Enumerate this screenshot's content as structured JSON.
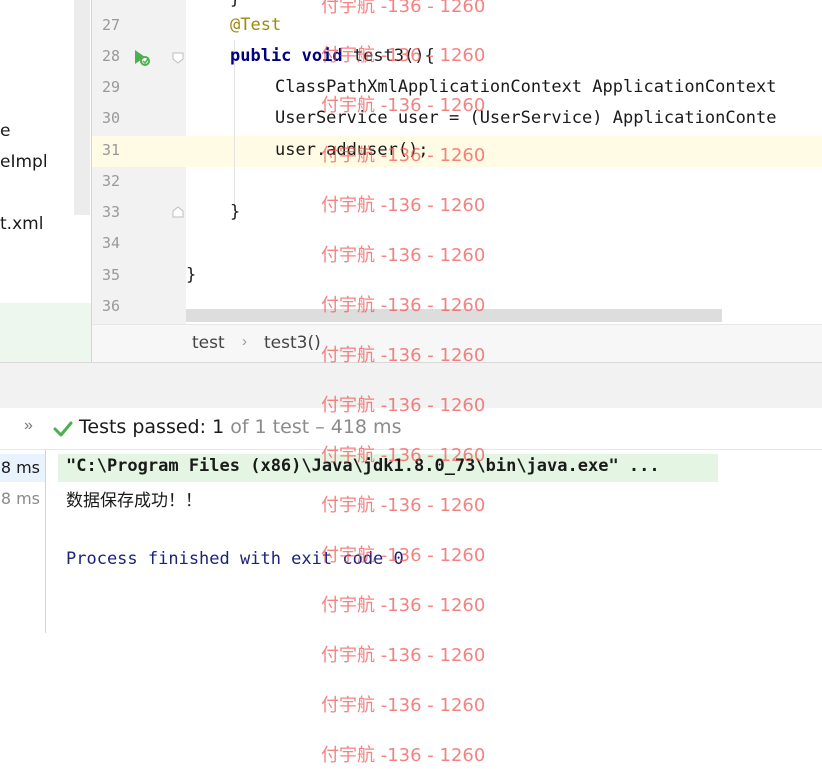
{
  "project_tree": {
    "items": [
      {
        "label": "e"
      },
      {
        "label": "eImpl"
      },
      {
        "label": "t.xml"
      }
    ]
  },
  "editor": {
    "line_numbers": [
      "27",
      "28",
      "29",
      "30",
      "31",
      "32",
      "33",
      "34",
      "35",
      "36"
    ],
    "code": {
      "annotation": "@Test",
      "method_public": "public",
      "method_void": "void",
      "method_sig": " test3(){",
      "line29": "ClassPathXmlApplicationContext ApplicationContext",
      "line30": "UserService user = (UserService) ApplicationConte",
      "line31": "user.adduser();",
      "close_method": "}",
      "close_class": "}",
      "top_partial": "}"
    },
    "current_line": "31"
  },
  "breadcrumb": {
    "items": [
      "test",
      "test3()"
    ],
    "separator": "›"
  },
  "test_status": {
    "expand": "»",
    "label": "Tests passed:",
    "count": "1",
    "rest": "of 1 test – 418 ms"
  },
  "tests_tree": {
    "times": [
      "8 ms",
      "8 ms"
    ]
  },
  "console": {
    "command": "\"C:\\Program Files (x86)\\Java\\jdk1.8.0_73\\bin\\java.exe\" ...",
    "output": "数据保存成功！！",
    "exit": "Process finished with exit code 0"
  },
  "watermark": {
    "text": "付宇航 -136 - 1260"
  },
  "colors": {
    "keyword": "#000080",
    "annotation": "#9e880d",
    "current_line": "#fffbe5",
    "success_green": "#4caf50",
    "watermark": "#ef5350"
  }
}
